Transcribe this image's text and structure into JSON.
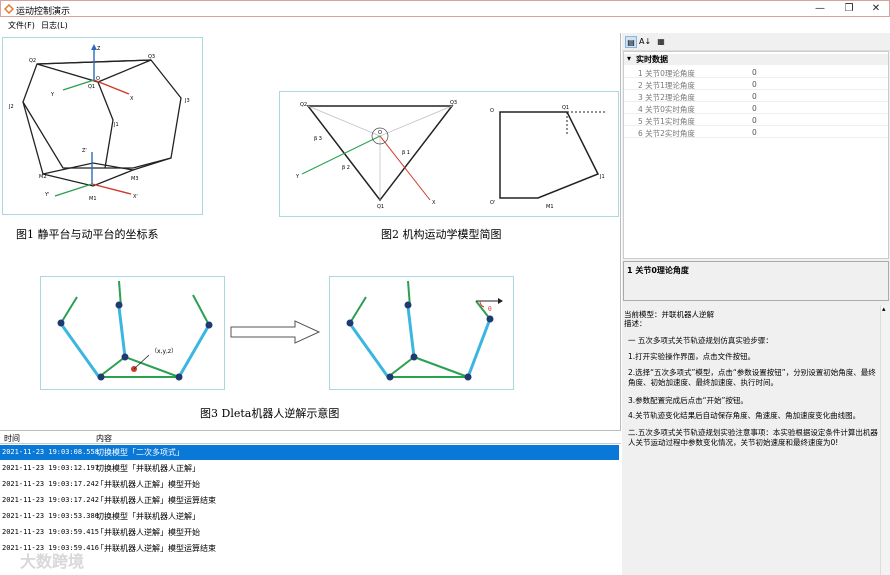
{
  "window": {
    "title": "运动控制演示",
    "icon": "app-logo-icon",
    "controls": {
      "minimize": "—",
      "maximize": "❐",
      "close": "✕"
    }
  },
  "menu": {
    "file": "文件(F)",
    "log": "日志(L)"
  },
  "figures": {
    "fig1": {
      "caption": "图1 静平台与动平台的坐标系",
      "labels": {
        "z": "Z",
        "q2": "Q2",
        "q3": "Q3",
        "o": "O",
        "q1": "Q1",
        "y": "Y",
        "x": "X",
        "j2": "J2",
        "j3": "J3",
        "j1": "J1",
        "z2": "Z'",
        "m2": "M2",
        "m3": "M3",
        "y2": "Y'",
        "x2": "X'",
        "m1": "M1"
      }
    },
    "fig2": {
      "caption": "图2 机构运动学模型简图",
      "labels": {
        "q2": "Q2",
        "q3": "Q3",
        "b3": "β 3",
        "o": "O",
        "b1": "β 1",
        "b2": "β 2",
        "y": "Y",
        "q1": "Q1",
        "x": "X",
        "o_r": "O",
        "q1_r": "Q1",
        "j1": "J1",
        "o2": "O'",
        "m1": "M1"
      }
    },
    "fig3": {
      "caption": "图3 Dleta机器人逆解示意图",
      "point_label": "（x,y,z）",
      "theta_label": "θ"
    }
  },
  "log": {
    "columns": [
      "时间",
      "内容"
    ],
    "rows": [
      {
        "time": "2021-11-23 19:03:08.558",
        "content": "切换模型「二次多项式」",
        "selected": true
      },
      {
        "time": "2021-11-23 19:03:12.197",
        "content": "切换模型「并联机器人正解」",
        "selected": false
      },
      {
        "time": "2021-11-23 19:03:17.242",
        "content": "「并联机器人正解」模型开始",
        "selected": false
      },
      {
        "time": "2021-11-23 19:03:17.242",
        "content": "「并联机器人正解」模型运算结束",
        "selected": false
      },
      {
        "time": "2021-11-23 19:03:53.380",
        "content": "切换模型「并联机器人逆解」",
        "selected": false
      },
      {
        "time": "2021-11-23 19:03:59.415",
        "content": "「并联机器人逆解」模型开始",
        "selected": false
      },
      {
        "time": "2021-11-23 19:03:59.416",
        "content": "「并联机器人逆解」模型运算结束",
        "selected": false
      }
    ]
  },
  "property_grid": {
    "toolbar": {
      "categorized": "▤",
      "alphabetical": "A↓",
      "pages": "▦"
    },
    "category": "实时数据",
    "rows": [
      {
        "name": "1 关节0理论角度",
        "value": "0"
      },
      {
        "name": "2 关节1理论角度",
        "value": "0"
      },
      {
        "name": "3 关节2理论角度",
        "value": "0"
      },
      {
        "name": "4 关节0实时角度",
        "value": "0"
      },
      {
        "name": "5 关节1实时角度",
        "value": "0"
      },
      {
        "name": "6 关节2实时角度",
        "value": "0"
      }
    ],
    "description_title": "1 关节0理论角度"
  },
  "notes": {
    "model": "当前模型：并联机器人逆解",
    "desc_label": "描述：",
    "section1": "一 五次多项式关节轨迹规划仿真实验步骤：",
    "step1": "1.打开实验操作界面，点击文件按钮。",
    "step2": "2.选择“五次多项式”模型，点击“参数设置按钮”，分别设置初始角度、最终角度、初始加速度、最终加速度、执行时间。",
    "step3": "3.参数配置完成后点击“开始”按钮。",
    "step4": "4.关节轨迹变化结果后自动保存角度、角速度、角加速度变化曲线图。",
    "section2": "二.五次多项式关节轨迹规划实验注意事项：本实验根据设定条件计算出机器人关节运动过程中参数变化情况，关节初始速度和最终速度为0!"
  },
  "watermark": "大数跨境"
}
